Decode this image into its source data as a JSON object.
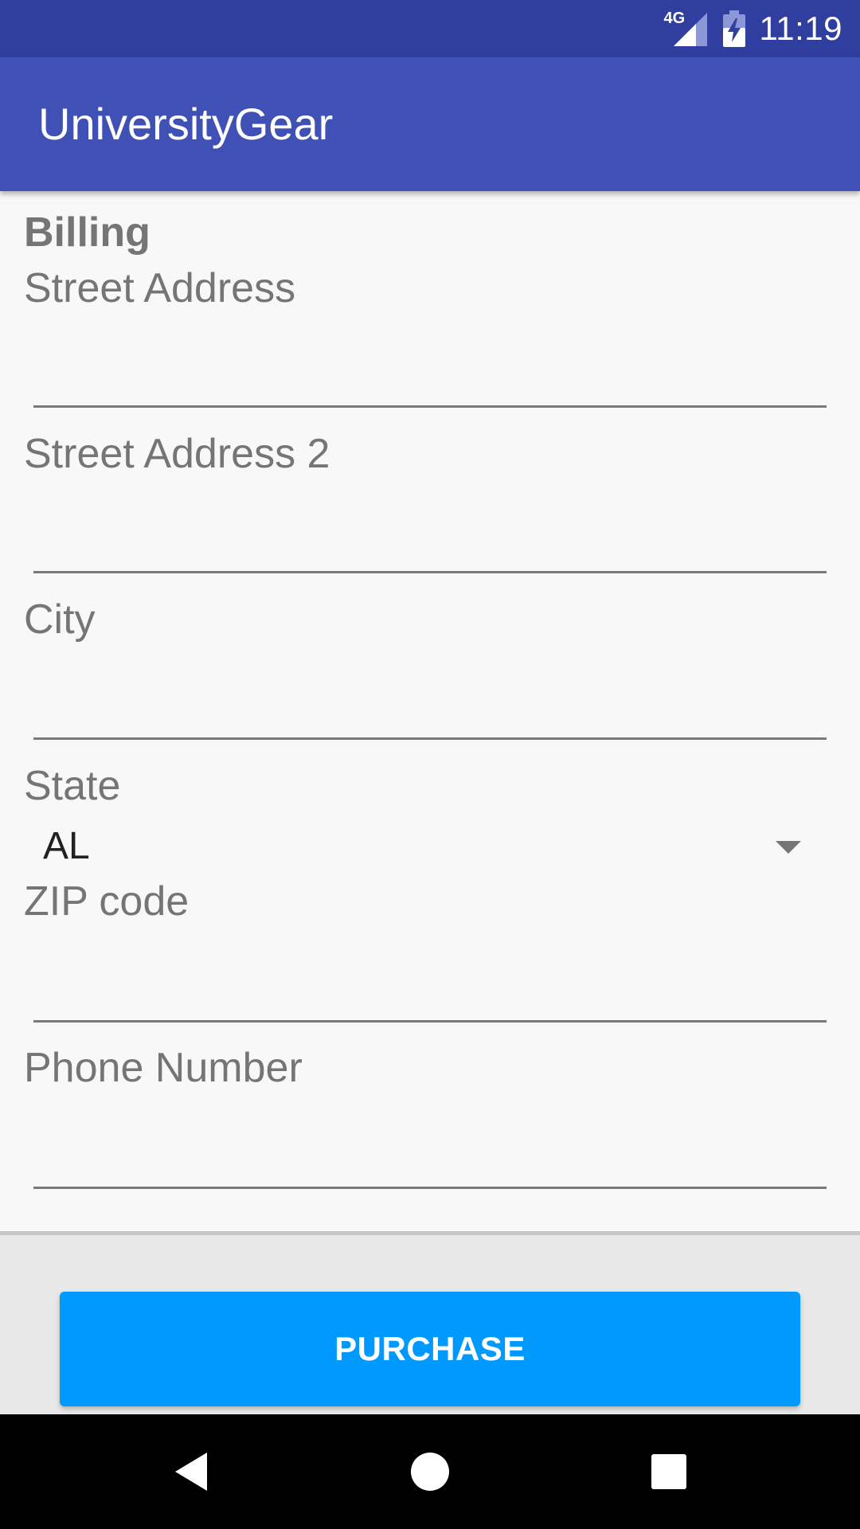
{
  "status_bar": {
    "network": "4G",
    "time": "11:19",
    "icons": [
      "signal-icon",
      "battery-charging-icon"
    ]
  },
  "app_bar": {
    "title": "UniversityGear"
  },
  "form": {
    "section_title": "Billing",
    "fields": [
      {
        "label": "Street Address",
        "value": ""
      },
      {
        "label": "Street Address 2",
        "value": ""
      },
      {
        "label": "City",
        "value": ""
      }
    ],
    "state": {
      "label": "State",
      "selected": "AL"
    },
    "zip": {
      "label": "ZIP code",
      "value": ""
    },
    "phone": {
      "label": "Phone Number",
      "value": ""
    }
  },
  "footer": {
    "purchase_label": "PURCHASE"
  },
  "nav_bar": {
    "icons": [
      "back-icon",
      "home-icon",
      "recents-icon"
    ]
  },
  "colors": {
    "status_bar": "#303f9f",
    "app_bar": "#3f51b5",
    "button": "#0099ff",
    "label_gray": "#757575"
  }
}
